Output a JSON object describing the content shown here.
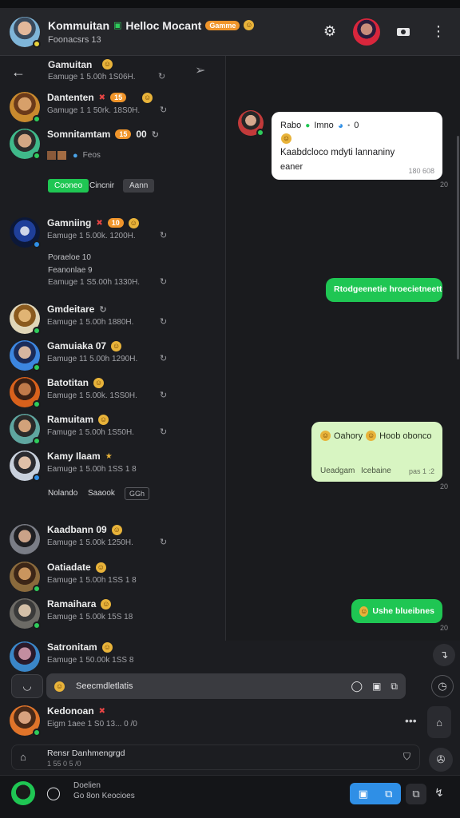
{
  "header": {
    "title": "Kommuitan",
    "title_suffix": "Helloc Mocant",
    "badge": "Gamme",
    "subtitle": "Foonacsrs 13"
  },
  "sidebar": {
    "back_label": "Gamuitan",
    "back_meta": "Eamuge 1 5.00h 1S06H.",
    "items": [
      {
        "name": "Dantenten",
        "badge": "15",
        "meta": "Gamuge 1 1 50rk. 18S0H."
      },
      {
        "name": "Somnitamtam",
        "badge": "15",
        "extra": "00",
        "meta": "Feos"
      },
      {
        "name": "Gamniing",
        "badge": "10",
        "meta": "Eamuge 1 5.00k. 1200H."
      },
      {
        "name": "Gmdeitare",
        "meta": "Eamuge 1 5.00h 1880H."
      },
      {
        "name": "Gamuiaka 07",
        "meta": "Eamuge 11 5.00h 1290H."
      },
      {
        "name": "Batotitan",
        "meta": "Eamuge 1 5.00k. 1SS0H."
      },
      {
        "name": "Ramuitam",
        "meta": "Famuge 1 5.00h 1S50H."
      },
      {
        "name": "Kamy Ilaam",
        "meta": "Eamuge 1 5.00h 1SS 1 8"
      },
      {
        "name": "Kaadbann 09",
        "meta": "Eamuge 1 5.00k 1250H."
      },
      {
        "name": "Oatiadate",
        "meta": "Eamuge 1 5.00h 1SS 1 8"
      },
      {
        "name": "Ramaihara",
        "meta": "Eamuge 1 5.00k 15S 18"
      },
      {
        "name": "Satronitam",
        "meta": "Eamuge 1 50.00k 1SS 8"
      }
    ],
    "chips": {
      "green": "Cooneo",
      "plain": "Cincnir",
      "grey": "Aann"
    },
    "sub_lines": {
      "a": "Poraeloe 10",
      "b": "Feanonlae 9",
      "c": "Eamuge 1 S5.00h 1330H."
    },
    "links": {
      "a": "Nolando",
      "b": "Saaook",
      "c": "GGh"
    }
  },
  "chat": {
    "messages": [
      {
        "kind": "in",
        "title": "Rabo",
        "title2": "Imno",
        "count": "0",
        "text": "Kaabdcloco mdyti lannaniny",
        "text2": "eaner",
        "time": "180 608",
        "outside": "20"
      },
      {
        "kind": "out",
        "text": "Rtodgeenetie hroecietneett"
      },
      {
        "kind": "out-light",
        "text": "Oahory",
        "text2": "Hoob obonco",
        "footer_a": "Ueadgam",
        "footer_b": "Icebaine",
        "time": "pas 1 :2",
        "outside": "20"
      },
      {
        "kind": "out",
        "text": "Ushe blueibnes",
        "outside": "20"
      }
    ]
  },
  "composer": {
    "placeholder": "Seecmdletlatis"
  },
  "bottom_contact": {
    "name": "Kedonoan",
    "meta": "Eigm 1aee 1 S0 13... 0 /0"
  },
  "bottom_search": {
    "label": "Rensr Danhmengrgd",
    "meta": "1 55 0 5 /0"
  },
  "tray": {
    "line1": "Doelien",
    "line2": "Go 8on Keocioes"
  },
  "colors": {
    "green": "#1fc653",
    "orange": "#f0952b",
    "blue": "#2f8fe6",
    "bg": "#1a1b1e"
  }
}
